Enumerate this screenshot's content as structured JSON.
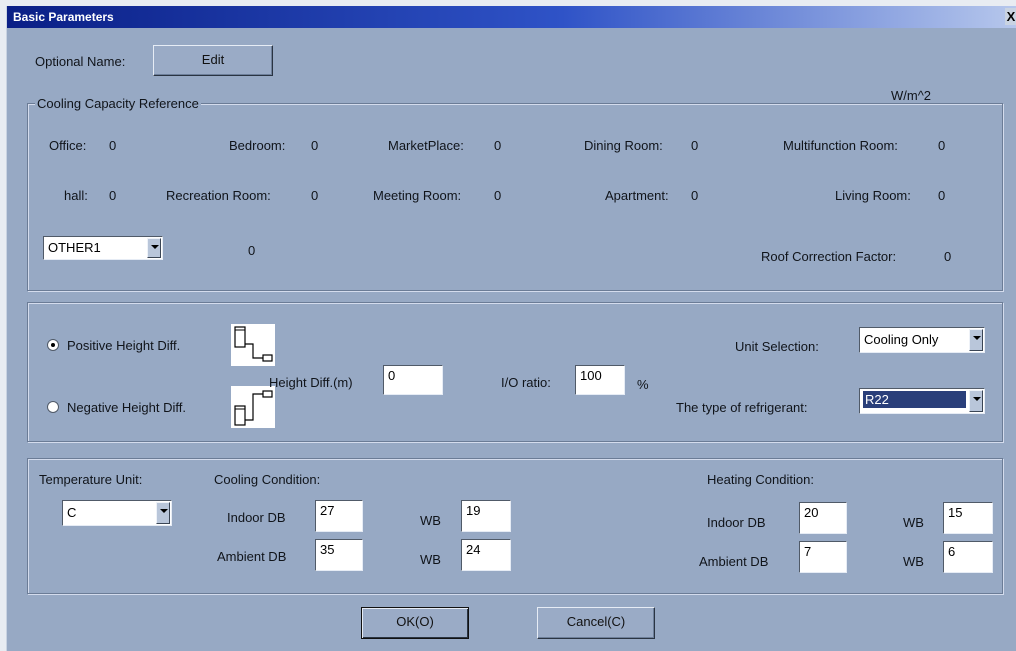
{
  "window": {
    "title": "Basic Parameters",
    "close_glyph": "X"
  },
  "optional_name": {
    "label": "Optional Name:",
    "button": "Edit"
  },
  "cooling_capacity": {
    "group_title": "Cooling Capacity Reference",
    "unit": "W/m^2",
    "row1": [
      {
        "label": "Office:",
        "value": "0"
      },
      {
        "label": "Bedroom:",
        "value": "0"
      },
      {
        "label": "MarketPlace:",
        "value": "0"
      },
      {
        "label": "Dining Room:",
        "value": "0"
      },
      {
        "label": "Multifunction Room:",
        "value": "0"
      }
    ],
    "row2": [
      {
        "label": "hall:",
        "value": "0"
      },
      {
        "label": "Recreation Room:",
        "value": "0"
      },
      {
        "label": "Meeting Room:",
        "value": "0"
      },
      {
        "label": "Apartment:",
        "value": "0"
      },
      {
        "label": "Living Room:",
        "value": "0"
      }
    ],
    "other_select": "OTHER1",
    "other_value": "0",
    "roof_label": "Roof Correction Factor:",
    "roof_value": "0"
  },
  "height": {
    "positive_label": "Positive Height Diff.",
    "negative_label": "Negative Height Diff.",
    "positive_selected": true,
    "height_diff_label": "Height Diff.(m)",
    "height_diff_value": "0",
    "io_ratio_label": "I/O ratio:",
    "io_ratio_value": "100",
    "io_ratio_unit": "%",
    "unit_selection_label": "Unit Selection:",
    "unit_selection_value": "Cooling Only",
    "refrigerant_label": "The type of refrigerant:",
    "refrigerant_value": "R22"
  },
  "conditions": {
    "temp_unit_label": "Temperature Unit:",
    "temp_unit_value": "C",
    "cooling_title": "Cooling Condition:",
    "heating_title": "Heating Condition:",
    "indoor_db_label": "Indoor DB",
    "ambient_db_label": "Ambient DB",
    "wb_label": "WB",
    "cooling": {
      "indoor_db": "27",
      "indoor_wb": "19",
      "ambient_db": "35",
      "ambient_wb": "24"
    },
    "heating": {
      "indoor_db": "20",
      "indoor_wb": "15",
      "ambient_db": "7",
      "ambient_wb": "6"
    }
  },
  "buttons": {
    "ok": "OK(O)",
    "cancel": "Cancel(C)"
  }
}
